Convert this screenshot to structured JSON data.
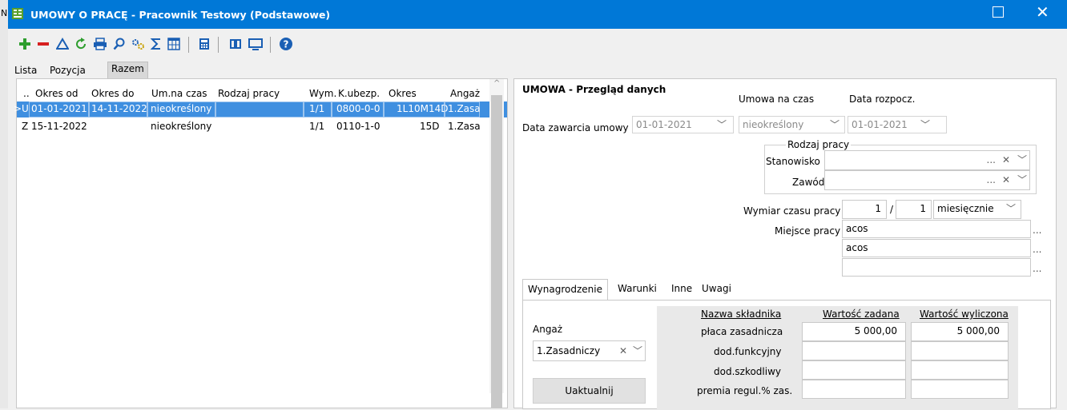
{
  "edge_char": "N",
  "window": {
    "title": "UMOWY O PRACĘ - Pracownik Testowy (Podstawowe)",
    "maximize_icon": "maximize-icon",
    "close_glyph": "✕"
  },
  "toolbar": {
    "buttons": [
      "add-icon",
      "remove-icon",
      "edit-icon",
      "refresh-icon",
      "print-icon",
      "search-icon",
      "settings-icon",
      "sum-icon",
      "columns-icon",
      "calculator-icon",
      "split-view-icon",
      "screen-icon",
      "help-icon"
    ],
    "colors": {
      "add": "#2e9e2e",
      "remove": "#d62020",
      "help": "#1a5fb4"
    }
  },
  "tabs": [
    {
      "label": "Lista"
    },
    {
      "label": "Pozycja"
    },
    {
      "label": "Razem"
    }
  ],
  "grid": {
    "columns": [
      "..",
      "Okres od",
      "Okres do",
      "Um.na czas",
      "Rodzaj pracy",
      "Wym.",
      "K.ubezp.",
      "Okres",
      "Angaż"
    ],
    "rows": [
      {
        "marker": "U",
        "okres_od": "01-01-2021",
        "okres_do": "14-11-2022",
        "um_na_czas": "nieokreślony",
        "rodzaj_pracy": "",
        "wym": "1/1",
        "k_ubezp": "0800-0-0",
        "okres": "1L10M14D",
        "angaz": "1.Zasa",
        "selected": true
      },
      {
        "marker": "Z",
        "okres_od": "15-11-2022",
        "okres_do": "",
        "um_na_czas": "nieokreślony",
        "rodzaj_pracy": "",
        "wym": "1/1",
        "k_ubezp": "0110-1-0",
        "okres": "15D",
        "angaz": "1.Zasa",
        "selected": false
      }
    ]
  },
  "details": {
    "title": "UMOWA - Przegląd danych",
    "data_zawarcia_label": "Data zawarcia umowy",
    "data_zawarcia_value": "01-01-2021",
    "umowa_na_czas_label": "Umowa na czas",
    "umowa_na_czas_value": "nieokreślony",
    "data_rozpocz_label": "Data rozpocz.",
    "data_rozpocz_value": "01-01-2021",
    "rodzaj_pracy_label": "Rodzaj pracy",
    "stanowisko_label": "Stanowisko",
    "stanowisko_value": "",
    "zawod_label": "Zawód",
    "zawod_value": "",
    "ellipsis": "...",
    "clear_glyph": "✕",
    "wymiar_label": "Wymiar czasu pracy",
    "wymiar_num": "1",
    "wymiar_sep": "/",
    "wymiar_den": "1",
    "wymiar_period": "miesięcznie",
    "miejsce_label": "Miejsce pracy",
    "miejsce_lines": [
      "acos",
      "acos",
      ""
    ]
  },
  "subtabs": [
    {
      "label": "Wynagrodzenie"
    },
    {
      "label": "Warunki"
    },
    {
      "label": "Inne"
    },
    {
      "label": "Uwagi"
    }
  ],
  "wynagrodzenie": {
    "angaz_label": "Angaż",
    "angaz_value": "1.Zasadniczy",
    "update_button": "Uaktualnij",
    "headers": {
      "nazwa": "Nazwa składnika",
      "zadana": "Wartość zadana",
      "wyliczona": "Wartość wyliczona"
    },
    "components": [
      {
        "name": "płaca zasadnicza",
        "zadana": "5 000,00",
        "wyliczona": "5 000,00"
      },
      {
        "name": "dod.funkcyjny",
        "zadana": "",
        "wyliczona": ""
      },
      {
        "name": "dod.szkodliwy",
        "zadana": "",
        "wyliczona": ""
      },
      {
        "name": "premia regul.% zas.",
        "zadana": "",
        "wyliczona": ""
      }
    ]
  }
}
